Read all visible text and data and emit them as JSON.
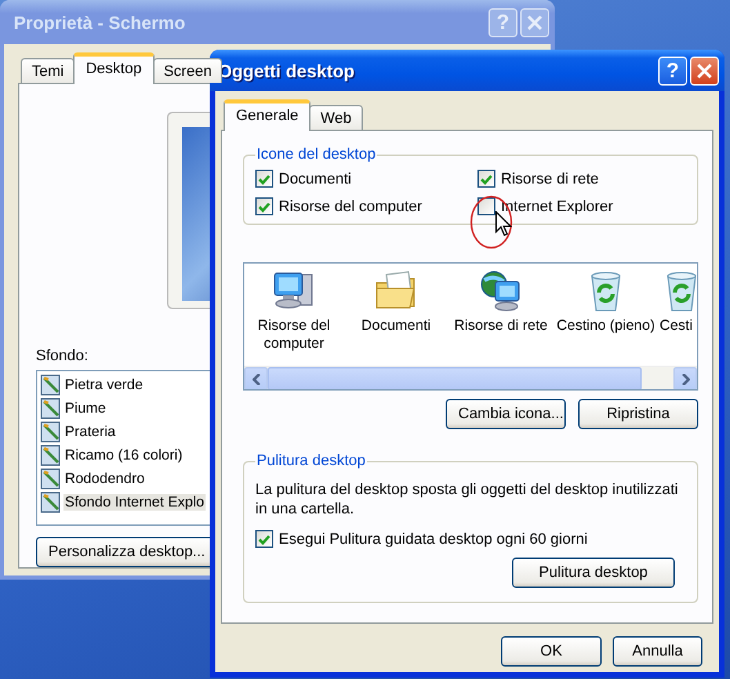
{
  "background_window": {
    "title": "Proprietà - Schermo",
    "help": "?",
    "tabs": [
      {
        "label": "Temi",
        "selected": false
      },
      {
        "label": "Desktop",
        "selected": true
      },
      {
        "label": "Screen",
        "selected": false
      }
    ],
    "background_label": "Sfondo:",
    "backgrounds": [
      {
        "label": "Pietra verde",
        "selected": false
      },
      {
        "label": "Piume",
        "selected": false
      },
      {
        "label": "Prateria",
        "selected": false
      },
      {
        "label": "Ricamo (16 colori)",
        "selected": false
      },
      {
        "label": "Rododendro",
        "selected": false
      },
      {
        "label": "Sfondo Internet Explo",
        "selected": true
      }
    ],
    "button": "Personalizza desktop..."
  },
  "dialog": {
    "title": "Oggetti desktop",
    "help": "?",
    "tabs": [
      {
        "label": "Generale",
        "selected": true
      },
      {
        "label": "Web",
        "selected": false
      }
    ],
    "icons_group": {
      "title": "Icone del desktop",
      "items": [
        {
          "label": "Documenti",
          "checked": true
        },
        {
          "label": "Risorse di rete",
          "checked": true
        },
        {
          "label": "Risorse del computer",
          "checked": true
        },
        {
          "label": "Internet Explorer",
          "checked": false
        }
      ]
    },
    "icon_list": [
      {
        "label": "Risorse del computer",
        "kind": "computer"
      },
      {
        "label": "Documenti",
        "kind": "folder"
      },
      {
        "label": "Risorse di rete",
        "kind": "network"
      },
      {
        "label": "Cestino (pieno)",
        "kind": "bin"
      },
      {
        "label": "Cesti",
        "kind": "bin"
      }
    ],
    "icon_buttons": [
      "Cambia icona...",
      "Ripristina"
    ],
    "cleanup_group": {
      "title": "Pulitura desktop",
      "description": "La pulitura del desktop sposta gli oggetti del desktop inutilizzati in una cartella.",
      "option": {
        "label": "Esegui Pulitura guidata desktop ogni 60 giorni",
        "checked": true
      },
      "button": "Pulitura desktop"
    },
    "footer_buttons": [
      "OK",
      "Annulla"
    ]
  }
}
